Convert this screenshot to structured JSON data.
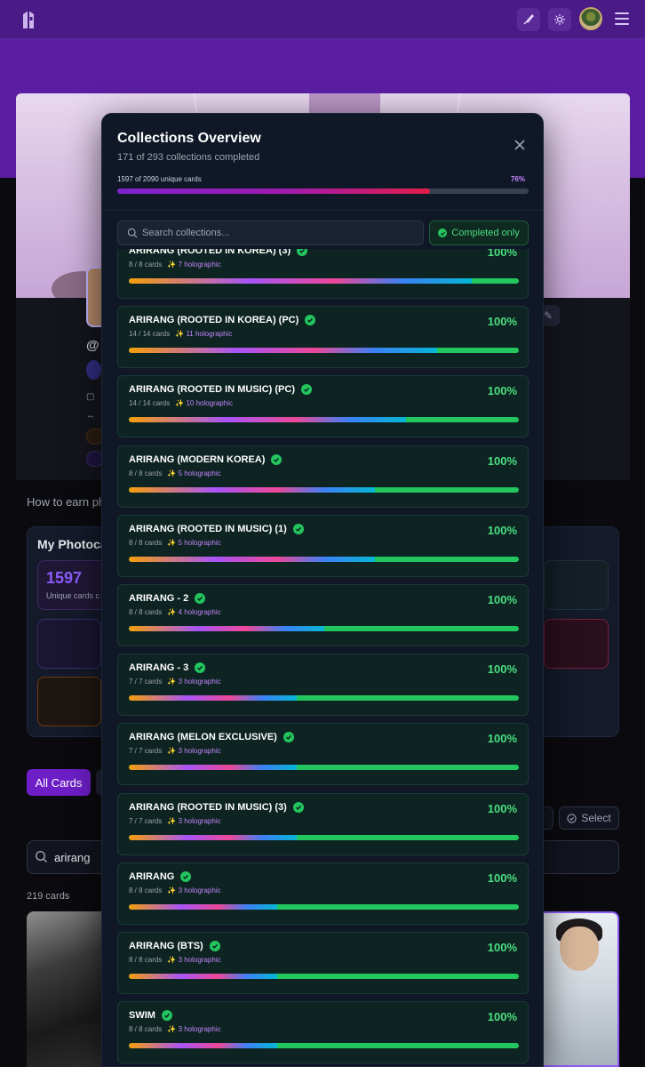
{
  "modal": {
    "title": "Collections Overview",
    "subtitle": "171 of 293 collections completed",
    "unique_cards": "1597 of 2090 unique cards",
    "percent": "76%",
    "progress": 0.76,
    "search_placeholder": "Search collections...",
    "completed_only": "Completed only"
  },
  "collections": [
    {
      "name": "ARIRANG (ROOTED IN KOREA) (3)",
      "count": "8 / 8 cards",
      "holo": "7 holographic",
      "percent": "100%",
      "holo_fraction": 0.88
    },
    {
      "name": "ARIRANG (ROOTED IN KOREA) (PC)",
      "count": "14 / 14 cards",
      "holo": "11 holographic",
      "percent": "100%",
      "holo_fraction": 0.79
    },
    {
      "name": "ARIRANG (ROOTED IN MUSIC) (PC)",
      "count": "14 / 14 cards",
      "holo": "10 holographic",
      "percent": "100%",
      "holo_fraction": 0.71
    },
    {
      "name": "ARIRANG (MODERN KOREA)",
      "count": "8 / 8 cards",
      "holo": "5 holographic",
      "percent": "100%",
      "holo_fraction": 0.63
    },
    {
      "name": "ARIRANG (ROOTED IN MUSIC) (1)",
      "count": "8 / 8 cards",
      "holo": "5 holographic",
      "percent": "100%",
      "holo_fraction": 0.63
    },
    {
      "name": "ARIRANG - 2",
      "count": "8 / 8 cards",
      "holo": "4 holographic",
      "percent": "100%",
      "holo_fraction": 0.5
    },
    {
      "name": "ARIRANG - 3",
      "count": "7 / 7 cards",
      "holo": "3 holographic",
      "percent": "100%",
      "holo_fraction": 0.43
    },
    {
      "name": "ARIRANG (MELON EXCLUSIVE)",
      "count": "7 / 7 cards",
      "holo": "3 holographic",
      "percent": "100%",
      "holo_fraction": 0.43
    },
    {
      "name": "ARIRANG (ROOTED IN MUSIC) (3)",
      "count": "7 / 7 cards",
      "holo": "3 holographic",
      "percent": "100%",
      "holo_fraction": 0.43
    },
    {
      "name": "ARIRANG",
      "count": "8 / 8 cards",
      "holo": "3 holographic",
      "percent": "100%",
      "holo_fraction": 0.38
    },
    {
      "name": "ARIRANG (BTS)",
      "count": "8 / 8 cards",
      "holo": "3 holographic",
      "percent": "100%",
      "holo_fraction": 0.38
    },
    {
      "name": "SWIM",
      "count": "8 / 8 cards",
      "holo": "3 holographic",
      "percent": "100%",
      "holo_fraction": 0.38
    }
  ],
  "background": {
    "how_to": "How to earn pho",
    "my_photocards": "My Photocard",
    "stat_value": "1597",
    "stat_label": "Unique cards c",
    "all_cards": "All Cards",
    "select": "Select",
    "search_value": "arirang",
    "cards_count": "219 cards"
  },
  "colors": {
    "nav": "#4a1a86",
    "accent": "#7e22ce",
    "success": "#22c55e"
  }
}
